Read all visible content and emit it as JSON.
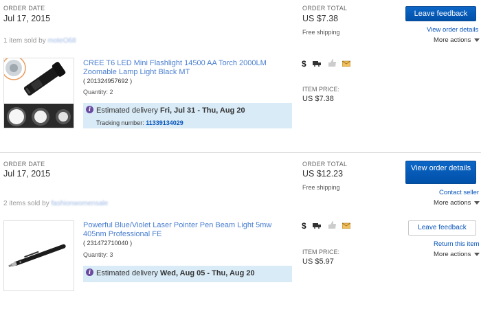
{
  "orders": [
    {
      "order_date_label": "ORDER DATE",
      "order_date": "Jul 17, 2015",
      "order_total_label": "ORDER TOTAL",
      "order_total": "US $7.38",
      "shipping": "Free shipping",
      "primary_button": "Leave feedback",
      "link_1": "View order details",
      "more_actions": "More actions",
      "sold_prefix": "1 item sold by",
      "seller": "moteO68",
      "item": {
        "title": "CREE T6 LED Mini Flashlight 14500 AA Torch 2000LM Zoomable Lamp Light Black MT",
        "item_id": "( 201324957692 )",
        "quantity": "Quantity: 2",
        "est_label": "Estimated delivery",
        "est_dates": "Fri, Jul 31 - Thu, Aug 20",
        "tracking_label": "Tracking number:",
        "tracking_number": "11339134029",
        "price_label": "ITEM PRICE:",
        "price": "US $7.38"
      }
    },
    {
      "order_date_label": "ORDER DATE",
      "order_date": "Jul 17, 2015",
      "order_total_label": "ORDER TOTAL",
      "order_total": "US $12.23",
      "shipping": "Free shipping",
      "primary_button": "View order details",
      "link_1": "Contact seller",
      "more_actions": "More actions",
      "sold_prefix": "2 items sold by",
      "seller": "fashionwomensale",
      "item": {
        "title": "Powerful Blue/Violet Laser Pointer Pen Beam Light 5mw 405nm Professional FE",
        "item_id": "( 231472710040 )",
        "quantity": "Quantity: 3",
        "est_label": "Estimated delivery",
        "est_dates": "Wed, Aug 05 - Thu, Aug 20",
        "price_label": "ITEM PRICE:",
        "price": "US $5.97",
        "secondary_button": "Leave feedback",
        "return_link": "Return this item",
        "more_actions": "More actions"
      }
    }
  ],
  "icons": [
    "dollar-icon",
    "shipped-truck-icon",
    "feedback-thumb-icon",
    "message-envelope-icon"
  ],
  "colors": {
    "primary_blue": "#0654ba",
    "delivery_bg": "#d9ebf7",
    "info_purple": "#6a4a9f"
  }
}
